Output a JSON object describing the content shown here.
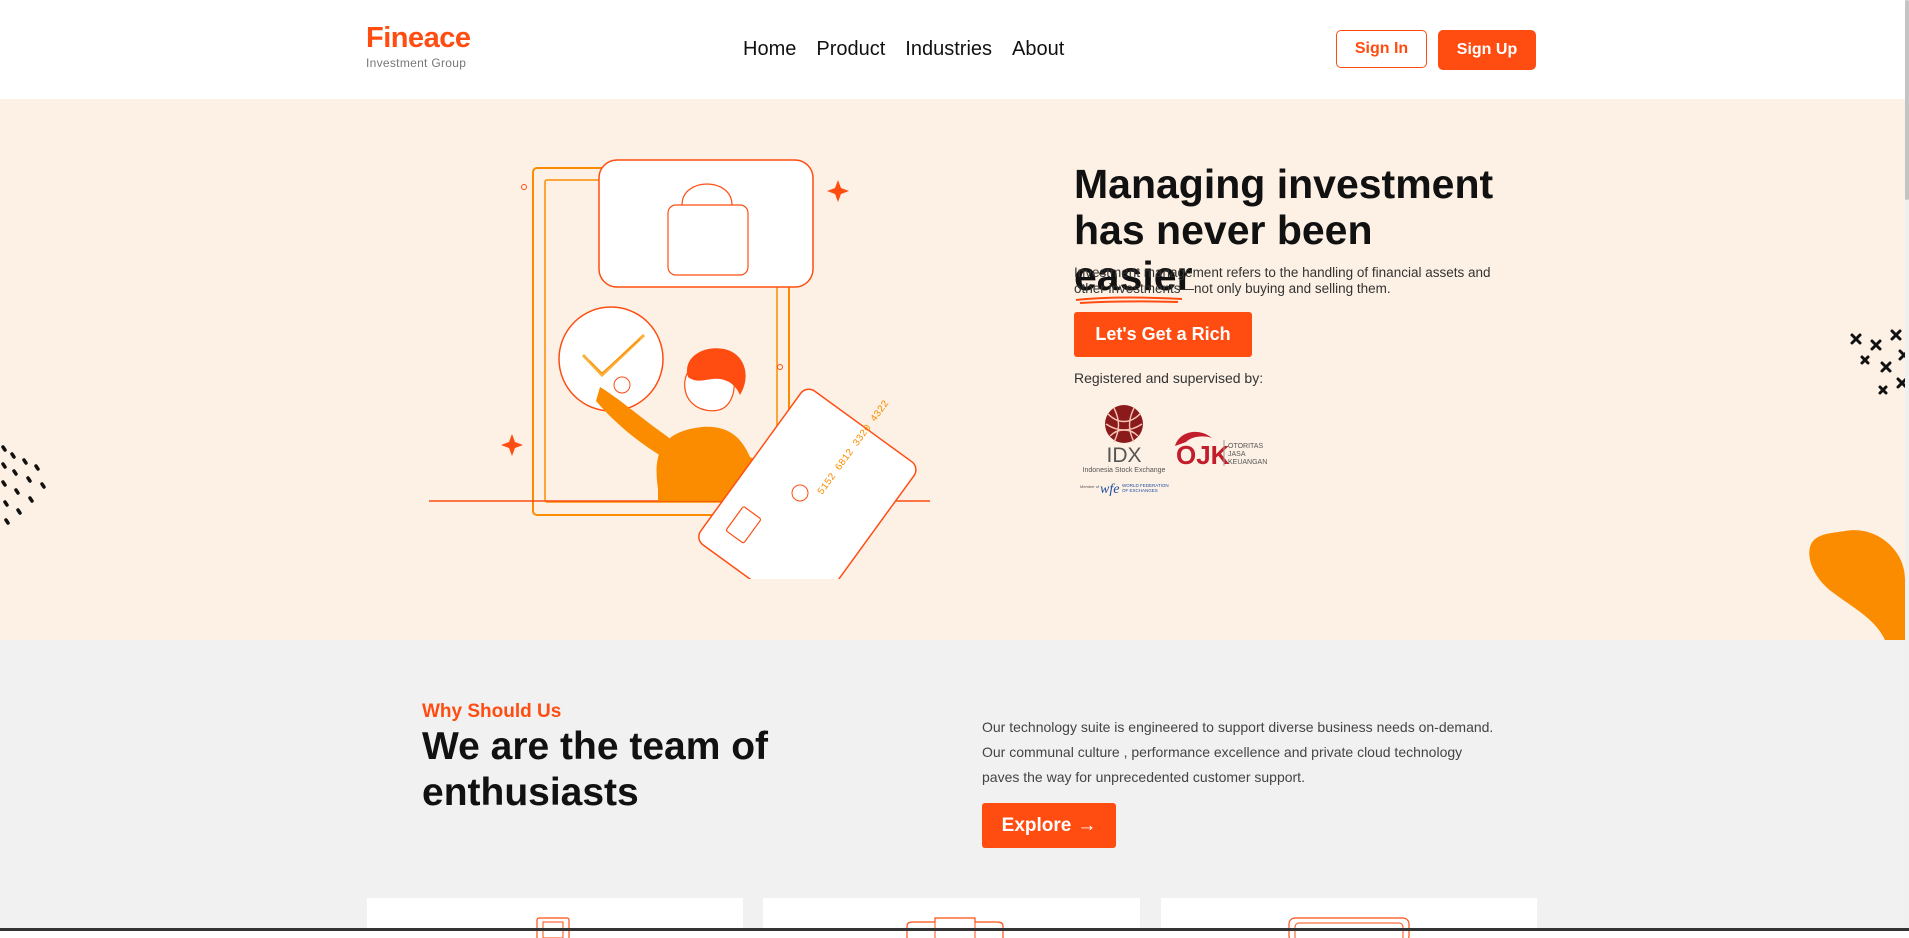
{
  "brand": {
    "name": "Fineace",
    "tagline": "Investment Group",
    "accent_color": "#ff4d12",
    "hero_bg": "#fdf1e5",
    "section_bg": "#f1f1f1"
  },
  "nav": {
    "items": [
      "Home",
      "Product",
      "Industries",
      "About"
    ],
    "sign_in": "Sign In",
    "sign_up": "Sign Up"
  },
  "hero": {
    "title_line1": "Managing investment",
    "title_line2_prefix": "has never been ",
    "title_highlight": "easier",
    "description": "Investment management refers to the handling of financial assets and other investments—not only buying and selling them.",
    "cta": "Let's Get a Rich",
    "registered_label": "Registered and supervised by:",
    "illustration_card_number": "5152 6812 3320 4322",
    "idx_logo": {
      "code": "IDX",
      "name": "Indonesia Stock Exchange",
      "member_text": "Member of",
      "wfe_mark": "wfe",
      "wfe_name_1": "WORLD FEDERATION",
      "wfe_name_2": "OF EXCHANGES"
    },
    "ojk_logo": {
      "mark": "OJK",
      "line1": "OTORITAS",
      "line2": "JASA",
      "line3": "KEUANGAN"
    }
  },
  "why": {
    "eyebrow": "Why Should Us",
    "title": "We are the team of enthusiasts",
    "description": "Our technology suite is engineered to support diverse business needs on-demand. Our communal culture , performance excellence and private cloud technology paves the way for unprecedented customer support.",
    "cta": "Explore",
    "cta_arrow": "→"
  },
  "icons": {
    "bag": "shopping-bag-icon",
    "check": "checkmark-icon",
    "card": "credit-card-icon",
    "sparkle": "sparkle-icon"
  }
}
